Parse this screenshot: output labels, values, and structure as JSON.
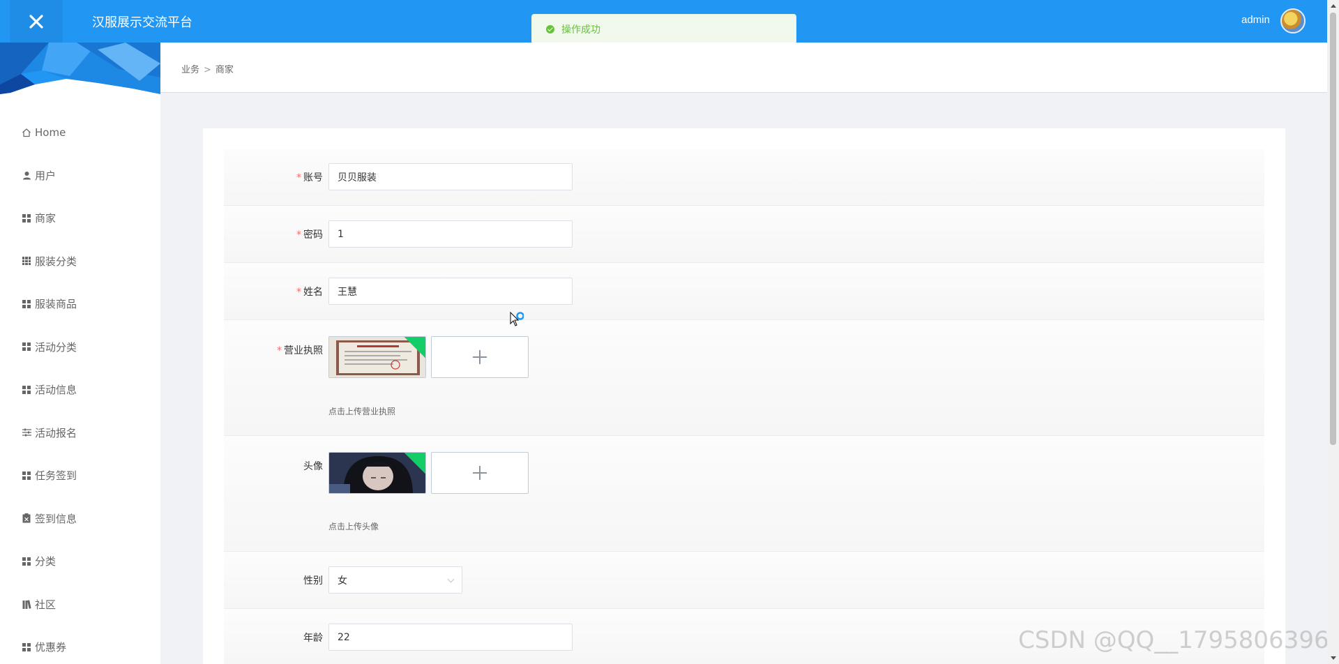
{
  "header": {
    "title": "汉服展示交流平台",
    "user": "admin"
  },
  "toast": {
    "message": "操作成功"
  },
  "sidebar": {
    "items": [
      {
        "label": "Home",
        "icon": "home-icon"
      },
      {
        "label": "用户",
        "icon": "user-icon"
      },
      {
        "label": "商家",
        "icon": "grid-icon"
      },
      {
        "label": "服装分类",
        "icon": "grid9-icon"
      },
      {
        "label": "服装商品",
        "icon": "grid-icon"
      },
      {
        "label": "活动分类",
        "icon": "grid-icon"
      },
      {
        "label": "活动信息",
        "icon": "grid-icon"
      },
      {
        "label": "活动报名",
        "icon": "sliders-icon"
      },
      {
        "label": "任务签到",
        "icon": "grid-icon"
      },
      {
        "label": "签到信息",
        "icon": "clipboard-icon"
      },
      {
        "label": "分类",
        "icon": "grid-icon"
      },
      {
        "label": "社区",
        "icon": "books-icon"
      },
      {
        "label": "优惠券",
        "icon": "grid-icon"
      }
    ]
  },
  "breadcrumb": {
    "level1": "业务",
    "separator": ">",
    "level2": "商家"
  },
  "form": {
    "account": {
      "label": "账号",
      "value": "贝贝服装",
      "required": true
    },
    "password": {
      "label": "密码",
      "value": "1",
      "required": true
    },
    "name": {
      "label": "姓名",
      "value": "王慧",
      "required": true
    },
    "license": {
      "label": "营业执照",
      "tip": "点击上传营业执照",
      "required": true
    },
    "avatar": {
      "label": "头像",
      "tip": "点击上传头像",
      "required": false
    },
    "gender": {
      "label": "性别",
      "value": "女"
    },
    "age": {
      "label": "年龄",
      "value": "22"
    }
  },
  "watermark": "CSDN @QQ__1795806396",
  "colors": {
    "primary": "#2196f3",
    "success": "#67c23a",
    "required": "#f56c6c",
    "upload_badge": "#13ce66"
  }
}
